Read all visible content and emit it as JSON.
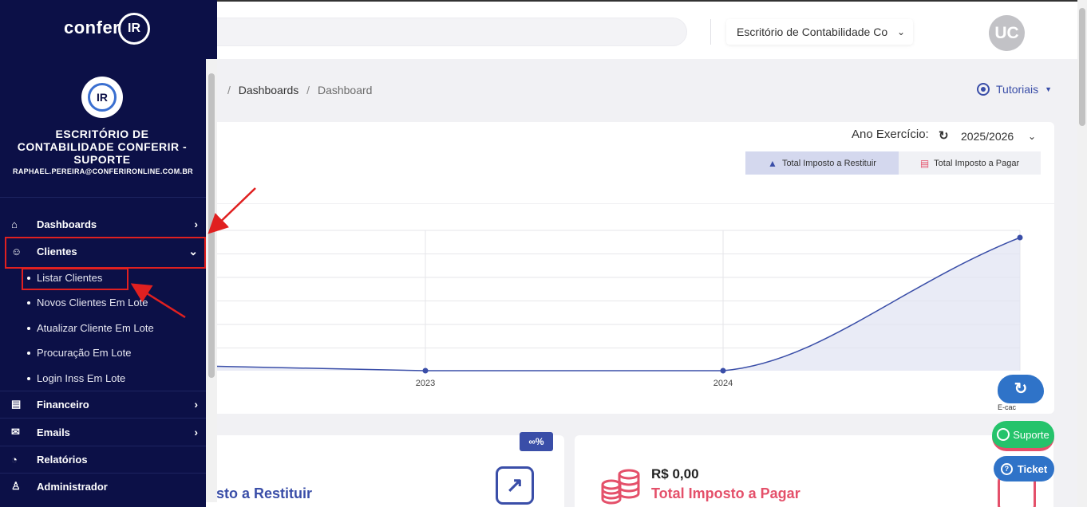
{
  "header": {
    "office_select": "Escritório de Contabilidade Co",
    "avatar_initials": "UC"
  },
  "breadcrumb": {
    "items": [
      "Dashboards",
      "Dashboard"
    ],
    "separator": "/"
  },
  "tutorials_label": "Tutoriais",
  "filters": {
    "year_label": "Ano Exercício:",
    "year_value": "2025/2026"
  },
  "toggles": {
    "restituir": "Total Imposto a Restituir",
    "pagar": "Total Imposto a Pagar"
  },
  "chart_data": {
    "type": "area",
    "x": [
      "",
      "2023",
      "2024",
      ""
    ],
    "series": [
      {
        "values": [
          0.05,
          0,
          0,
          1
        ]
      }
    ],
    "tick_labels": [
      "2023",
      "2024"
    ],
    "grid": true,
    "colors": {
      "line": "#3a4ea8",
      "fill": "#dfe2f2"
    }
  },
  "ecac": {
    "label": "E-cac"
  },
  "cards": {
    "restituir": {
      "badge": "∞%",
      "title": "osto a Restituir"
    },
    "pagar": {
      "value": "R$ 0,00",
      "title": "Total Imposto a Pagar"
    }
  },
  "floating": {
    "suporte": "Suporte",
    "ticket": "Ticket"
  },
  "sidebar": {
    "logo_text": "confer",
    "logo_ir": "IR",
    "org_initials": "IR",
    "org_name_lines": [
      "ESCRITÓRIO DE",
      "CONTABILIDADE CONFERIR -",
      "SUPORTE"
    ],
    "email": "RAPHAEL.PEREIRA@CONFERIRONLINE.COM.BR",
    "items": [
      {
        "label": "Dashboards",
        "icon": "home-icon"
      },
      {
        "label": "Clientes",
        "icon": "users-icon"
      },
      {
        "label": "Financeiro",
        "icon": "card-icon"
      },
      {
        "label": "Emails",
        "icon": "mail-icon"
      },
      {
        "label": "Relatórios",
        "icon": "pie-icon"
      },
      {
        "label": "Administrador",
        "icon": "admin-icon"
      }
    ],
    "clientes_sub": [
      "Listar Clientes",
      "Novos Clientes Em Lote",
      "Atualizar Cliente Em Lote",
      "Procuração Em Lote",
      "Login Inss Em Lote"
    ]
  },
  "colors": {
    "sidebar_bg": "#0c1047",
    "primary": "#3a4ea8",
    "danger": "#e4506a",
    "highlight": "#e02020"
  }
}
